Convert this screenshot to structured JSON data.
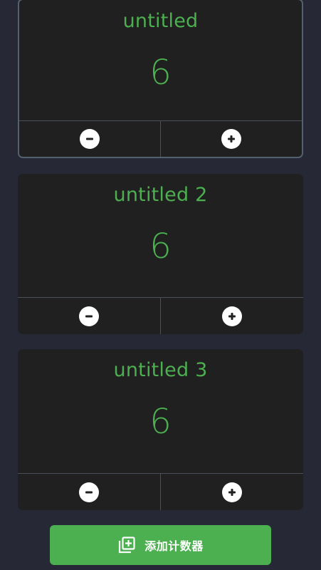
{
  "counters": [
    {
      "title": "untitled",
      "value": "6"
    },
    {
      "title": "untitled 2",
      "value": "6"
    },
    {
      "title": "untitled 3",
      "value": "6"
    }
  ],
  "add_button": {
    "label": "添加计数器",
    "icon": "library-add-icon"
  },
  "colors": {
    "background": "#262935",
    "card": "#202020",
    "accent": "#4caf50",
    "selected_border": "#55606e"
  }
}
